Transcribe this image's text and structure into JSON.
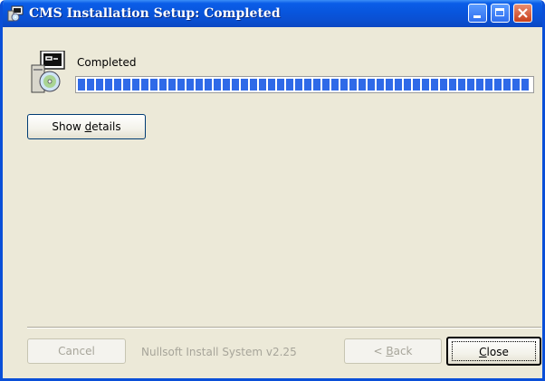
{
  "window": {
    "title": "CMS Installation Setup: Completed",
    "controls": {
      "minimize": "minimize-icon",
      "maximize": "maximize-icon",
      "close": "close-icon"
    }
  },
  "status": {
    "label": "Completed",
    "progress_fraction": 1.0
  },
  "buttons": {
    "show_details": {
      "pre": "Show ",
      "accel": "d",
      "post": "etails"
    },
    "cancel": "Cancel",
    "back": {
      "pre": "< ",
      "accel": "B",
      "post": "ack"
    },
    "close": {
      "accel": "C",
      "post": "lose"
    }
  },
  "branding": "Nullsoft Install System v2.25",
  "colors": {
    "titlebar": "#0855dd",
    "progress_fill": "#2f6ae8",
    "window_bg": "#ece9d8"
  }
}
